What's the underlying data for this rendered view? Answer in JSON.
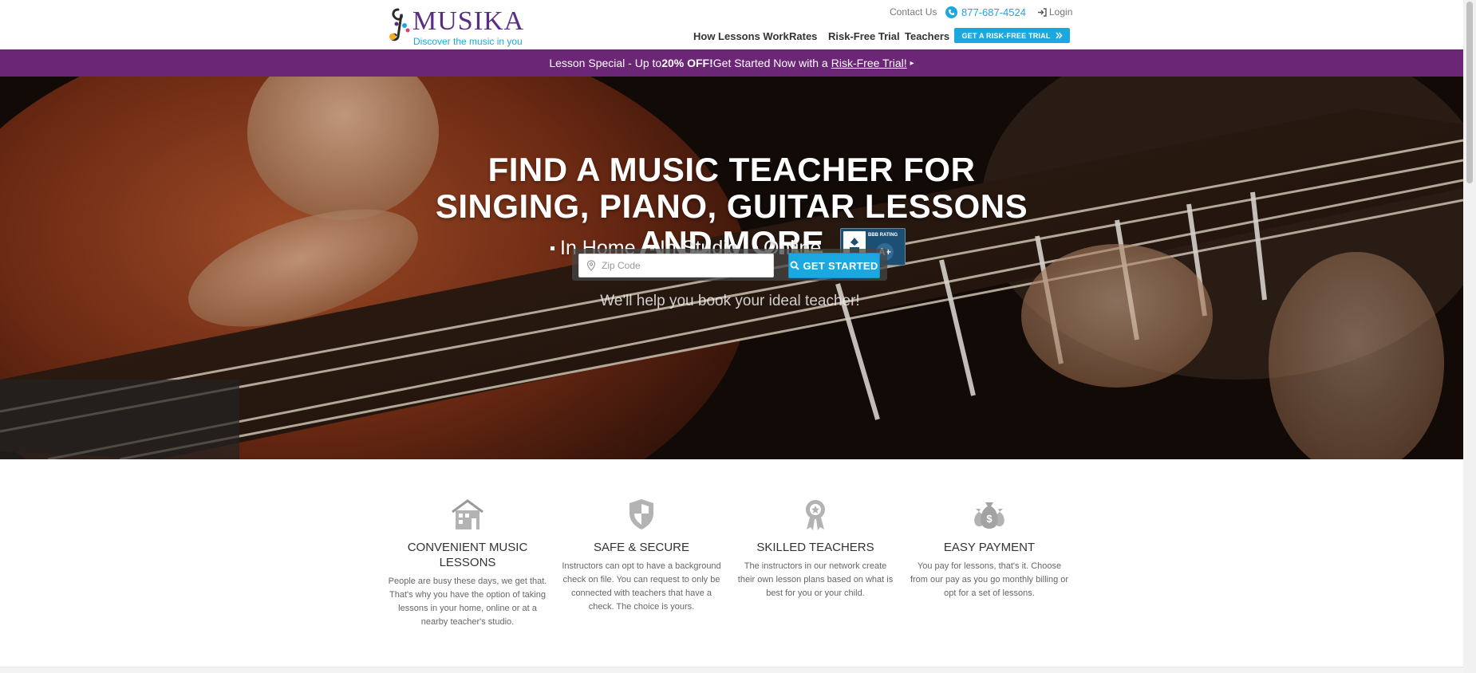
{
  "header": {
    "logo": {
      "name": "MUSIKA",
      "tagline": "Discover the music in you",
      "icon": "music-note-icon"
    },
    "utility": {
      "contact": "Contact Us",
      "phone": "877-687-4524",
      "login": "Login"
    },
    "nav": [
      "How Lessons Work",
      "Rates",
      "Risk-Free Trial",
      "Teachers"
    ],
    "cta": "GET A RISK-FREE TRIAL",
    "colors": {
      "brand_purple": "#5a2d82",
      "accent_blue": "#1ba8e0"
    }
  },
  "promo": {
    "prefix": "Lesson Special - Up to ",
    "highlight": "20% OFF!",
    "middle": " Get Started Now with a ",
    "link": "Risk-Free Trial!",
    "background": "#6b2676"
  },
  "hero": {
    "title": "FIND A MUSIC TEACHER FOR SINGING, PIANO, GUITAR LESSONS AND MORE",
    "modes": [
      "In Home",
      "In Studio",
      "Online"
    ],
    "bbb": {
      "label": "BBB RATING",
      "grade": "A+"
    },
    "subtitle": "We'll help you book your ideal teacher!",
    "search": {
      "placeholder": "Zip Code",
      "value": "",
      "button": "GET STARTED"
    }
  },
  "features": [
    {
      "icon": "house-icon",
      "title": "CONVENIENT MUSIC LESSONS",
      "desc": "People are busy these days, we get that. That's why you have the option of taking lessons in your home, online or at a nearby teacher's studio."
    },
    {
      "icon": "shield-icon",
      "title": "SAFE & SECURE",
      "desc": "Instructors can opt to have a background check on file. You can request to only be connected with teachers that have a check. The choice is yours."
    },
    {
      "icon": "award-ribbon-icon",
      "title": "SKILLED TEACHERS",
      "desc": "The instructors in our network create their own lesson plans based on what is best for you or your child."
    },
    {
      "icon": "money-bags-icon",
      "title": "EASY PAYMENT",
      "desc": "You pay for lessons, that's it. Choose from our pay as you go monthly billing or opt for a set of lessons."
    }
  ]
}
